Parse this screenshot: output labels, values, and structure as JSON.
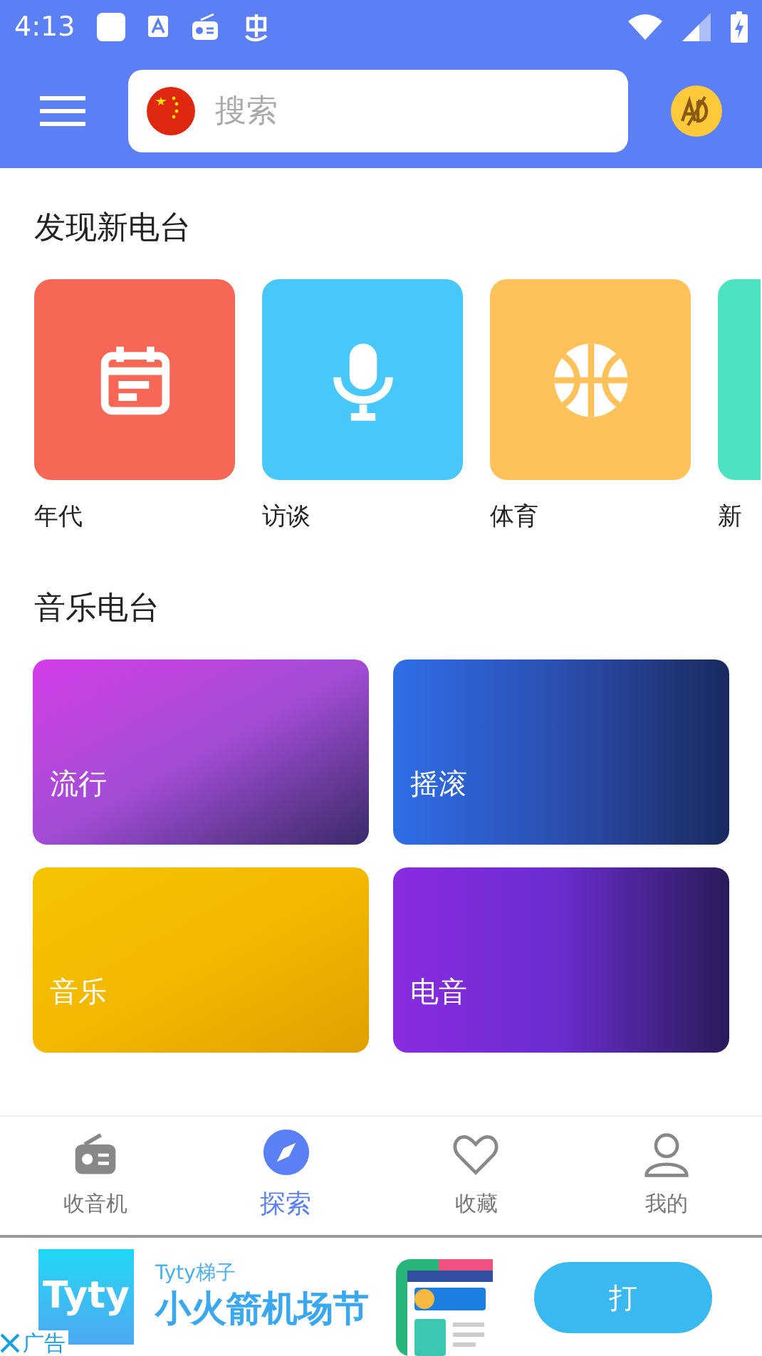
{
  "status_bar": {
    "time": "4:13"
  },
  "header": {
    "search": {
      "placeholder": "搜索"
    }
  },
  "discover": {
    "title": "发现新电台",
    "items": [
      {
        "label": "年代",
        "kind": "calendar",
        "color": "#f76756"
      },
      {
        "label": "访谈",
        "kind": "mic",
        "color": "#48c8fa"
      },
      {
        "label": "体育",
        "kind": "ball",
        "color": "#ffc25a"
      },
      {
        "label": "新",
        "kind": "partial",
        "color": "#4de3c0"
      }
    ]
  },
  "music": {
    "title": "音乐电台",
    "items": [
      {
        "label": "流行",
        "kind": "pop"
      },
      {
        "label": "摇滚",
        "kind": "rock"
      },
      {
        "label": "音乐",
        "kind": "music"
      },
      {
        "label": "电音",
        "kind": "edm"
      }
    ]
  },
  "bottom_nav": [
    {
      "label": "收音机",
      "kind": "radio",
      "selected": false
    },
    {
      "label": "探索",
      "kind": "explore",
      "selected": true
    },
    {
      "label": "收藏",
      "kind": "heart",
      "selected": false
    },
    {
      "label": "我的",
      "kind": "user",
      "selected": false
    }
  ],
  "ad": {
    "logo": "Tyty",
    "brand": "Tyty梯子",
    "headline": "小火箭机场节",
    "button": "打",
    "close_label": "广告"
  }
}
